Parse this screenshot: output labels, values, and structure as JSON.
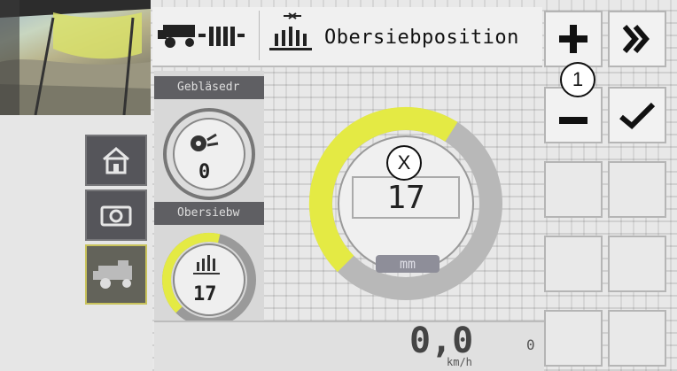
{
  "header": {
    "title": "Obersiebposition"
  },
  "widgets": {
    "blower": {
      "label": "Gebläsedr",
      "value": "0"
    },
    "upper_sieve": {
      "label": "Obersiebw",
      "value": "17",
      "level": 0.55
    }
  },
  "main_gauge": {
    "value": "17",
    "unit": "mm",
    "level": 0.62,
    "accent": "#e4ea44"
  },
  "keypad": {
    "plus_icon": "plus-icon",
    "minus_icon": "minus-icon",
    "forward_icon": "double-chevron-icon",
    "confirm_icon": "check-icon"
  },
  "status": {
    "speed_value": "0,0",
    "speed_unit": "km/h",
    "extra_value": "0"
  },
  "annotations": {
    "callout_1": "1",
    "callout_x": "X"
  },
  "colors": {
    "accent_yellow": "#e4ea44",
    "dark_button": "#55555a"
  }
}
